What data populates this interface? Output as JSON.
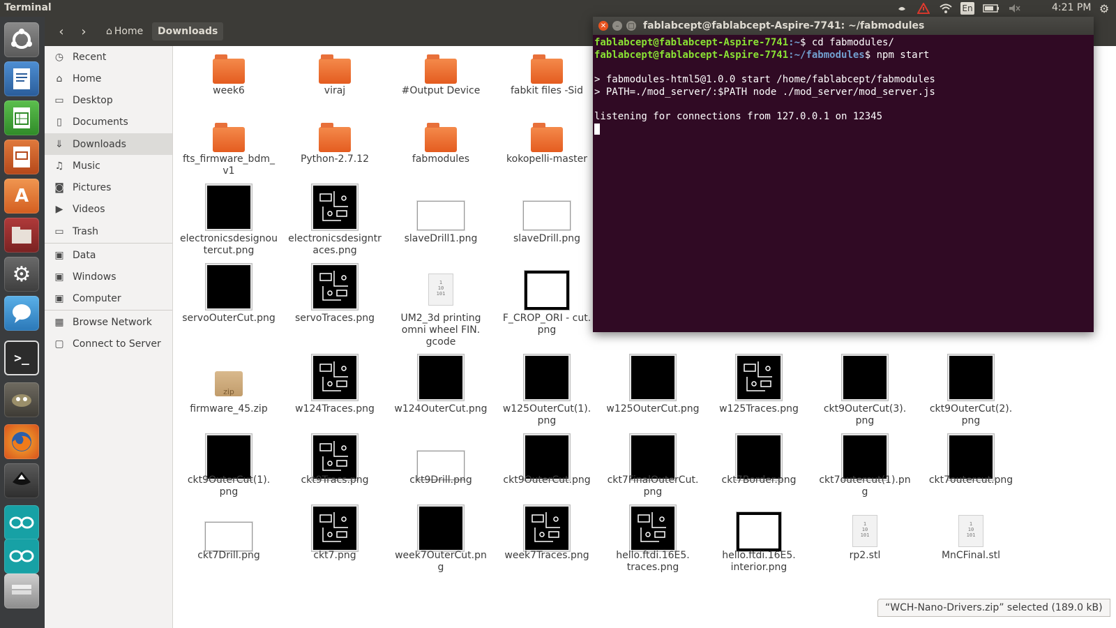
{
  "topbar": {
    "app_title": "Terminal",
    "keyboard_layout": "En",
    "time": "4:21 PM",
    "indicators": [
      "dropbox-icon",
      "warning-icon",
      "wifi-icon",
      "keyboard-icon",
      "battery-icon",
      "volume-icon",
      "gear-icon"
    ]
  },
  "launcher": {
    "items": [
      "ubuntu-logo-icon",
      "writer-icon",
      "calc-icon",
      "impress-icon",
      "software-center-icon",
      "files-icon",
      "settings-icon",
      "empathy-icon",
      "terminal-icon",
      "gimp-icon",
      "firefox-icon",
      "inkscape-icon",
      "arduino-icon",
      "arduino-icon",
      "disk-icon"
    ]
  },
  "files": {
    "breadcrumb_home": "Home",
    "breadcrumb_current": "Downloads",
    "sidebar": [
      {
        "label": "Recent",
        "icon": "clock-icon"
      },
      {
        "label": "Home",
        "icon": "home-icon"
      },
      {
        "label": "Desktop",
        "icon": "desktop-icon"
      },
      {
        "label": "Documents",
        "icon": "document-icon"
      },
      {
        "label": "Downloads",
        "icon": "download-icon"
      },
      {
        "label": "Music",
        "icon": "music-icon"
      },
      {
        "label": "Pictures",
        "icon": "camera-icon"
      },
      {
        "label": "Videos",
        "icon": "video-icon"
      },
      {
        "label": "Trash",
        "icon": "trash-icon"
      },
      {
        "label": "Data",
        "icon": "drive-icon"
      },
      {
        "label": "Windows",
        "icon": "drive-icon"
      },
      {
        "label": "Computer",
        "icon": "drive-icon"
      },
      {
        "label": "Browse Network",
        "icon": "network-icon"
      },
      {
        "label": "Connect to Server",
        "icon": "server-icon"
      }
    ],
    "items": [
      {
        "name": "week6",
        "type": "folder"
      },
      {
        "name": "viraj",
        "type": "folder"
      },
      {
        "name": "#Output Device",
        "type": "folder"
      },
      {
        "name": "fabkit files -Sid",
        "type": "folder"
      },
      {
        "name": "fts_firmware_bdm_\nv1",
        "type": "folder"
      },
      {
        "name": "Python-2.7.12",
        "type": "folder"
      },
      {
        "name": "fabmodules",
        "type": "folder"
      },
      {
        "name": "kokopelli-master",
        "type": "folder"
      },
      {
        "name": "electronicsdesignou\ntercut.png",
        "type": "black"
      },
      {
        "name": "electronicsdesigntr\naces.png",
        "type": "traces"
      },
      {
        "name": "slaveDrill1.png",
        "type": "white"
      },
      {
        "name": "slaveDrill.png",
        "type": "white"
      },
      {
        "name": "servoOuterCut.png",
        "type": "black"
      },
      {
        "name": "servoTraces.png",
        "type": "traces"
      },
      {
        "name": "UM2_3d printing\nomni wheel FIN.\ngcode",
        "type": "doc"
      },
      {
        "name": "F_CROP_ORI - cut.\npng",
        "type": "frame"
      },
      {
        "name": "firmware_45.zip",
        "type": "zip"
      },
      {
        "name": "w124Traces.png",
        "type": "traces"
      },
      {
        "name": "w124OuterCut.png",
        "type": "black"
      },
      {
        "name": "w125OuterCut(1).\npng",
        "type": "black"
      },
      {
        "name": "w125OuterCut.png",
        "type": "black"
      },
      {
        "name": "w125Traces.png",
        "type": "traces"
      },
      {
        "name": "ckt9OuterCut(3).\npng",
        "type": "black"
      },
      {
        "name": "ckt9OuterCut(2).\npng",
        "type": "black"
      },
      {
        "name": "ckt9OuterCut(1).\npng",
        "type": "black"
      },
      {
        "name": "ckt9Tracs.png",
        "type": "traces"
      },
      {
        "name": "ckt9Drill.png",
        "type": "white"
      },
      {
        "name": "ckt9OuterCut.png",
        "type": "black"
      },
      {
        "name": "ckt7FinalOuterCut.\npng",
        "type": "black"
      },
      {
        "name": "ckt7Border.png",
        "type": "black"
      },
      {
        "name": "ckt7outercut(1).png",
        "type": "black"
      },
      {
        "name": "ckt7outercut.png",
        "type": "black"
      },
      {
        "name": "ckt7Drill.png",
        "type": "white"
      },
      {
        "name": "ckt7.png",
        "type": "traces"
      },
      {
        "name": "week7OuterCut.png",
        "type": "black"
      },
      {
        "name": "week7Traces.png",
        "type": "traces"
      },
      {
        "name": "hello.ftdi.16E5.\ntraces.png",
        "type": "traces"
      },
      {
        "name": "hello.ftdi.16E5.\ninterior.png",
        "type": "frame"
      },
      {
        "name": "rp2.stl",
        "type": "doc"
      },
      {
        "name": "MnCFinal.stl",
        "type": "doc"
      }
    ],
    "status": "“WCH-Nano-Drivers.zip” selected  (189.0 kB)"
  },
  "terminal": {
    "title": "fablabcept@fablabcept-Aspire-7741: ~/fabmodules",
    "prompt_user": "fablabcept@fablabcept-Aspire-7741",
    "line1_path": ":~",
    "line1_cmd": "$ cd fabmodules/",
    "line2_path": ":~/fabmodules",
    "line2_cmd": "$ npm start",
    "out1": "> fabmodules-html5@1.0.0 start /home/fablabcept/fabmodules",
    "out2": "> PATH=./mod_server/:$PATH node ./mod_server/mod_server.js",
    "out3": "listening for connections from 127.0.0.1 on 12345"
  },
  "colors": {
    "terminal_bg": "#300a24",
    "prompt_green": "#8ae234",
    "prompt_blue": "#729fcf",
    "folder_orange": "#e8642a"
  }
}
